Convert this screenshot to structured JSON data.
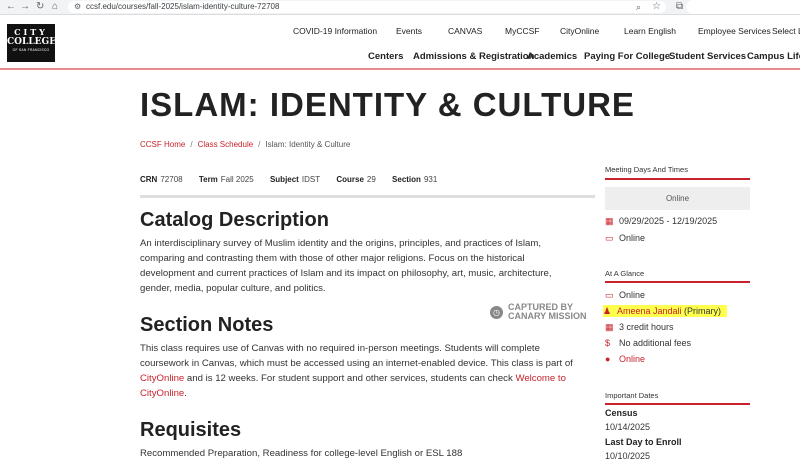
{
  "browser": {
    "url": "ccsf.edu/courses/fall-2025/islam-identity-culture-72708"
  },
  "header": {
    "logo": {
      "line1": "CITY",
      "line2": "COLLEGE",
      "line3": "OF SAN FRANCISCO"
    },
    "top_nav": [
      "COVID-19 Information",
      "Events",
      "CANVAS",
      "MyCCSF",
      "CityOnline",
      "Learn English",
      "Employee Services",
      "Select La"
    ],
    "main_nav": [
      "Centers",
      "Admissions & Registration",
      "Academics",
      "Paying For College",
      "Student Services",
      "Campus Life"
    ]
  },
  "page": {
    "title": "ISLAM: IDENTITY & CULTURE",
    "breadcrumb": [
      "CCSF Home",
      "Class Schedule",
      "Islam: Identity & Culture"
    ],
    "meta": {
      "crn_label": "CRN",
      "crn": "72708",
      "term_label": "Term",
      "term": "Fall 2025",
      "subject_label": "Subject",
      "subject": "IDST",
      "course_label": "Course",
      "course": "29",
      "section_label": "Section",
      "section": "931"
    },
    "catalog": {
      "heading": "Catalog Description",
      "text": "An interdisciplinary survey of Muslim identity and the origins, principles, and practices of Islam, comparing and contrasting them with those of other major religions. Focus on the historical development and current practices of Islam and its impact on philosophy, art, music, architecture, gender, media, popular culture, and politics."
    },
    "notes": {
      "heading": "Section Notes",
      "text_1": "This class requires use of Canvas with no required in-person meetings. Students will complete coursework in Canvas, which must be accessed using an internet-enabled device. This class is part of ",
      "link_1": "CityOnline",
      "text_2": " and is 12 weeks. For student support and other services, students can check ",
      "link_2": "Welcome to CityOnline",
      "text_3": "."
    },
    "requisites": {
      "heading": "Requisites",
      "text": "Recommended Preparation, Readiness for college-level English or ESL 188"
    },
    "watermark": {
      "line1": "CAPTURED BY",
      "line2": "CANARY MISSION"
    }
  },
  "sidebar": {
    "meeting_label": "Meeting Days And Times",
    "meeting_box": "Online",
    "dates": "09/29/2025 - 12/19/2025",
    "location": "Online",
    "glance_label": "At A Glance",
    "glance_mode": "Online",
    "instructor_name": "Ameena Jandali",
    "instructor_role": " (Primary)",
    "credits": "3 credit hours",
    "fees": "No additional fees",
    "campus": "Online",
    "important_label": "Important Dates",
    "census_label": "Census",
    "census_date": "10/14/2025",
    "enroll_label": "Last Day to Enroll",
    "enroll_date": "10/10/2025"
  },
  "colors": {
    "accent": "#c8232c",
    "highlight": "#ffff4d"
  }
}
